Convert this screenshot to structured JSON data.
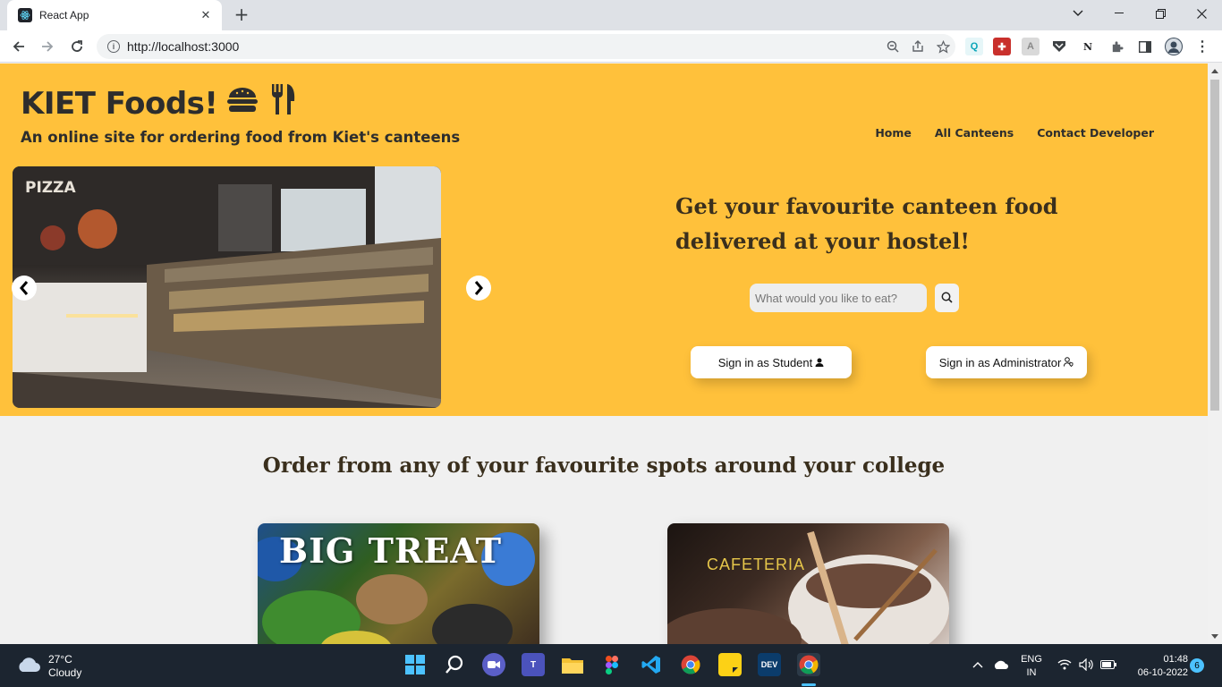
{
  "browser": {
    "tab_title": "React App",
    "url": "http://localhost:3000",
    "new_tab_symbol": "+",
    "close_symbol": "✕"
  },
  "header": {
    "brand": "KIET Foods!",
    "tagline": "An online site for ordering food from Kiet's canteens",
    "nav": [
      "Home",
      "All Canteens",
      "Contact Developer"
    ]
  },
  "hero": {
    "headline_line1": "Get your favourite canteen food",
    "headline_line2": "delivered at your hostel!",
    "search_placeholder": "What would you like to eat?",
    "signin_student": "Sign in as Student",
    "signin_admin": "Sign in as Administrator",
    "carousel_sign": "PIZZA"
  },
  "spots": {
    "title": "Order from any of your favourite spots around your college",
    "cards": [
      "BIG TREAT",
      "CAFETERIA"
    ]
  },
  "taskbar": {
    "temperature": "27°C",
    "condition": "Cloudy",
    "lang_line1": "ENG",
    "lang_line2": "IN",
    "time": "01:48",
    "date": "06-10-2022",
    "notifications": "6"
  },
  "colors": {
    "hero_bg": "#ffc13b",
    "page_bg": "#f0f0f0",
    "text_dark": "#2d2d2d"
  }
}
